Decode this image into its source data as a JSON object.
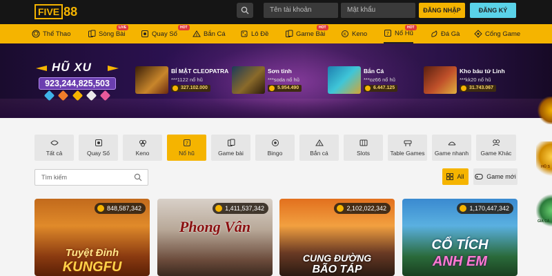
{
  "header": {
    "logo_text": "FIVE",
    "logo_num": "88",
    "username_placeholder": "Tên tài khoản",
    "password_placeholder": "Mật khẩu",
    "login_label": "ĐĂNG NHẬP",
    "register_label": "ĐĂNG KÝ"
  },
  "nav": {
    "items": [
      {
        "label": "Thể Thao",
        "icon": "ball-icon"
      },
      {
        "label": "Sòng Bài",
        "icon": "cards-icon",
        "badge": "LIVE"
      },
      {
        "label": "Quay Số",
        "icon": "lottery-icon",
        "badge": "HOT"
      },
      {
        "label": "Bắn Cá",
        "icon": "fish-icon"
      },
      {
        "label": "Lô Đề",
        "icon": "dice-icon"
      },
      {
        "label": "Game Bài",
        "icon": "cards-icon",
        "badge": "HOT"
      },
      {
        "label": "Keno",
        "icon": "keno-icon"
      },
      {
        "label": "Nổ Hũ",
        "icon": "slot-icon",
        "badge": "HOT"
      },
      {
        "label": "Đá Gà",
        "icon": "rooster-icon"
      },
      {
        "label": "Cổng Game",
        "icon": "gamepad-icon"
      }
    ]
  },
  "banner": {
    "title": "HŨ XU",
    "amount": "923,244,825,503",
    "jackpots": [
      {
        "name": "BÍ MẬT CLEOPATRA",
        "sub": "***1122 nổ hũ",
        "amount": "327.102.000"
      },
      {
        "name": "Sơn tinh",
        "sub": "***soda nổ hũ",
        "amount": "5.954.490"
      },
      {
        "name": "Bắn Cá",
        "sub": "***oz66 nổ hũ",
        "amount": "6.447.125"
      },
      {
        "name": "Kho báu tứ Linh",
        "sub": "***kk20 nổ hũ",
        "amount": "31.743.067"
      }
    ]
  },
  "categories": [
    {
      "label": "Tất cả",
      "icon": "grid-icon"
    },
    {
      "label": "Quay Số",
      "icon": "lottery-icon"
    },
    {
      "label": "Keno",
      "icon": "keno-icon"
    },
    {
      "label": "Nổ hũ",
      "icon": "slot-icon",
      "active": true
    },
    {
      "label": "Game bài",
      "icon": "cards-icon"
    },
    {
      "label": "Bingo",
      "icon": "bingo-icon"
    },
    {
      "label": "Bắn cá",
      "icon": "fish-icon"
    },
    {
      "label": "Slots",
      "icon": "slots-icon"
    },
    {
      "label": "Table Games",
      "icon": "table-icon"
    },
    {
      "label": "Game nhanh",
      "icon": "fast-icon"
    },
    {
      "label": "Game Khác",
      "icon": "other-icon"
    }
  ],
  "search": {
    "placeholder": "Tìm kiếm"
  },
  "filters": {
    "all_label": "All",
    "new_label": "Game mới"
  },
  "games": [
    {
      "title_line1": "Tuyệt Đỉnh",
      "title_line2": "KUNGFU",
      "amount": "848,587,342"
    },
    {
      "title_line1": "Phong Vân",
      "title_line2": "",
      "amount": "1,411,537,342"
    },
    {
      "title_line1": "CUNG ĐƯỜNG",
      "title_line2": "BÃO TÁP",
      "amount": "2,102,022,342"
    },
    {
      "title_line1": "CỔ TÍCH",
      "title_line2": "ANH EM",
      "amount": "1,170,447,342"
    }
  ],
  "side": {
    "text1": "HŨ S",
    "text2": "GIA CẢ"
  },
  "colors": {
    "brand": "#f5b400",
    "register": "#5ad2e8",
    "topbar": "#151515"
  }
}
